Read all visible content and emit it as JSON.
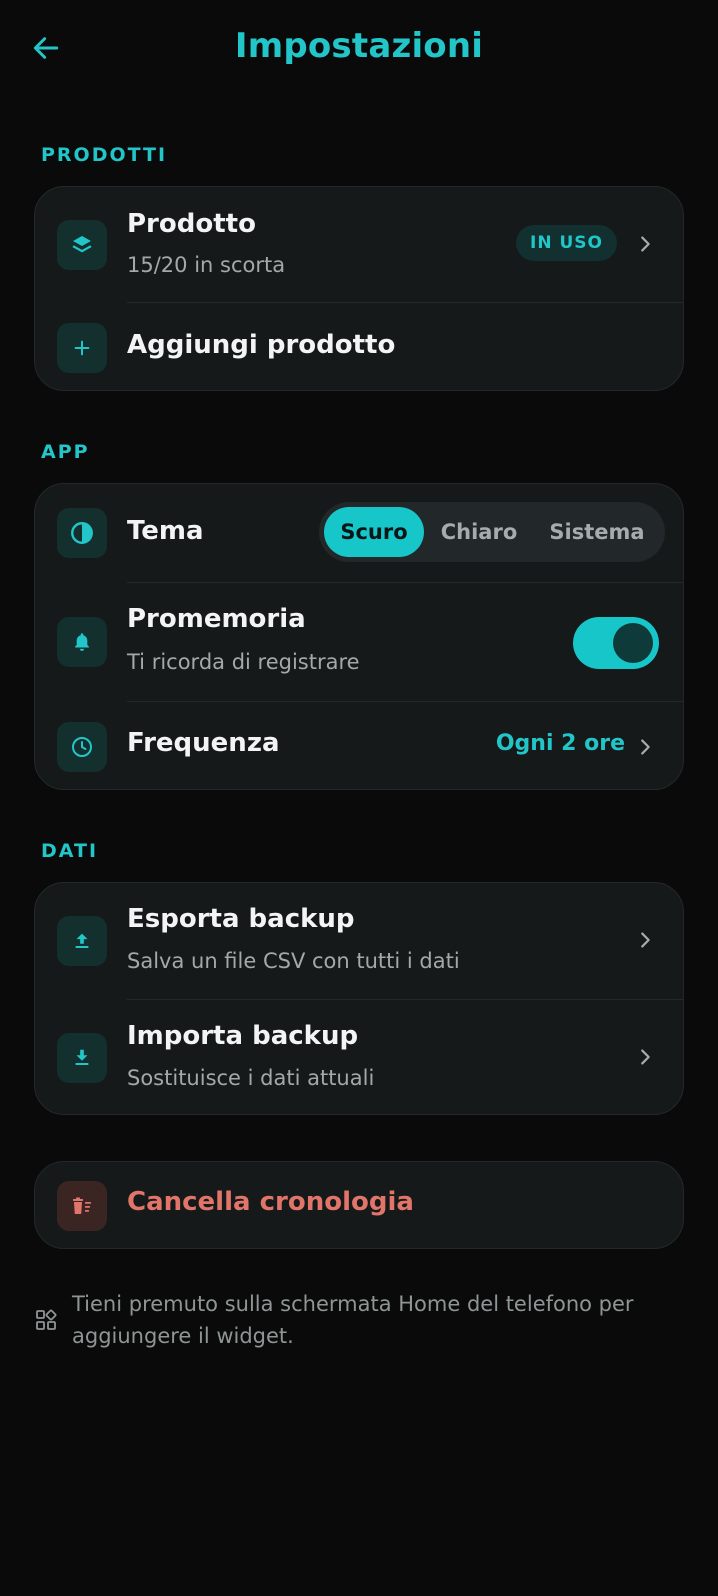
{
  "header": {
    "title": "Impostazioni",
    "back_icon": "arrow-left-icon"
  },
  "colors": {
    "accent": "#22c5c8",
    "danger": "#e2756a",
    "background": "#0a0a0a",
    "card": "#15191a"
  },
  "sections": {
    "products": {
      "label": "PRODOTTI",
      "product": {
        "title": "Prodotto",
        "subtitle": "15/20 in scorta",
        "badge": "IN USO",
        "icon": "layers-icon"
      },
      "add": {
        "label": "Aggiungi prodotto",
        "icon": "plus-icon"
      }
    },
    "app": {
      "label": "APP",
      "theme": {
        "title": "Tema",
        "options": [
          "Scuro",
          "Chiaro",
          "Sistema"
        ],
        "selected": "Scuro",
        "icon": "contrast-icon"
      },
      "reminder": {
        "title": "Promemoria",
        "subtitle": "Ti ricorda di registrare",
        "enabled": true,
        "icon": "bell-icon"
      },
      "frequency": {
        "title": "Frequenza",
        "value": "Ogni 2 ore",
        "icon": "clock-icon"
      }
    },
    "data": {
      "label": "DATI",
      "export": {
        "title": "Esporta backup",
        "subtitle": "Salva un file CSV con tutti i dati",
        "icon": "upload-icon"
      },
      "import": {
        "title": "Importa backup",
        "subtitle": "Sostituisce i dati attuali",
        "icon": "download-icon"
      }
    },
    "danger": {
      "title": "Cancella cronologia",
      "icon": "trash-icon"
    }
  },
  "tip": {
    "text": "Tieni premuto sulla schermata Home del telefono per aggiungere il widget.",
    "icon": "widgets-icon"
  }
}
